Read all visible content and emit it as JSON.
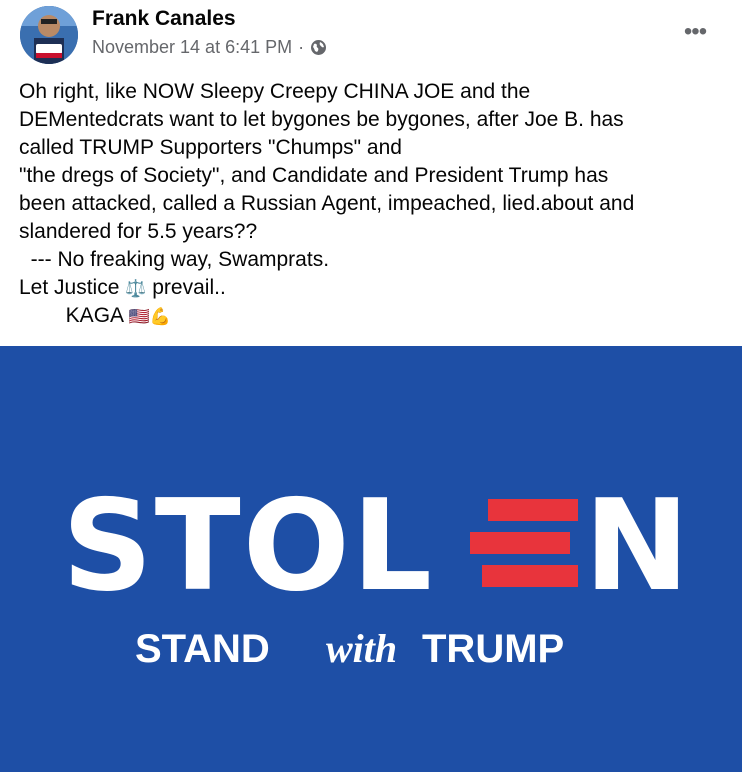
{
  "post": {
    "author": "Frank Canales",
    "avatar_badge": "Trump 2020",
    "timestamp": "November 14 at 6:41 PM",
    "separator": "·",
    "privacy_icon": "globe-icon",
    "more_icon": "more-options-icon",
    "more_label": "•••",
    "text_lines": [
      "Oh right, like NOW Sleepy Creepy CHINA JOE and the",
      "DEMentedcrats want to let bygones be bygones, after Joe B. has",
      "called TRUMP Supporters \"Chumps\" and",
      "\"the dregs of Society\", and Candidate and President Trump has",
      "been attacked, called a Russian Agent, impeached, lied.about and",
      "slandered for 5.5 years??",
      "  --- No freaking way, Swamprats.",
      "Let Justice",
      "prevail..",
      "        KAGA"
    ],
    "emojis": {
      "scales": "⚖️",
      "flag": "🇺🇸",
      "muscle": "💪"
    }
  },
  "image": {
    "headline_left": "STOL",
    "headline_right": "N",
    "subline_left": "STAND",
    "subline_mid": "with",
    "subline_right": "TRUMP",
    "colors": {
      "background": "#1e4fa6",
      "white": "#ffffff",
      "red": "#e8343c"
    }
  },
  "colors": {
    "meta_gray": "#65676b",
    "text": "#050505"
  }
}
